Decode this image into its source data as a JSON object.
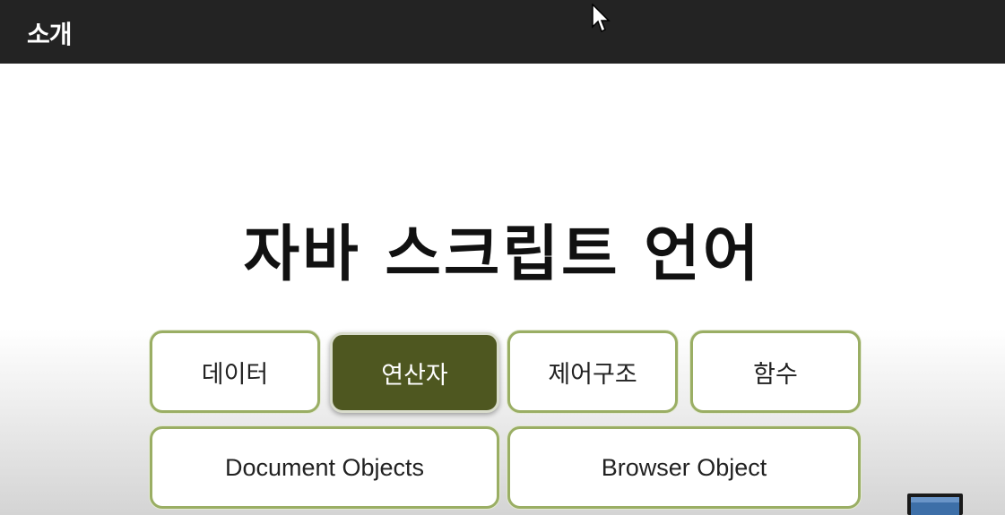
{
  "header": {
    "title": "소개"
  },
  "main": {
    "title": "자바 스크립트 언어"
  },
  "topics": {
    "data": "데이터",
    "operators": "연산자",
    "control": "제어구조",
    "functions": "함수",
    "document_objects": "Document Objects",
    "browser_object": "Browser Object",
    "selected": "연산자"
  },
  "colors": {
    "header_bg": "#232323",
    "accent_border": "#9aae64",
    "active_bg": "#4e5720"
  },
  "icons": [
    "mouse-cursor-icon",
    "laptop-icon"
  ]
}
